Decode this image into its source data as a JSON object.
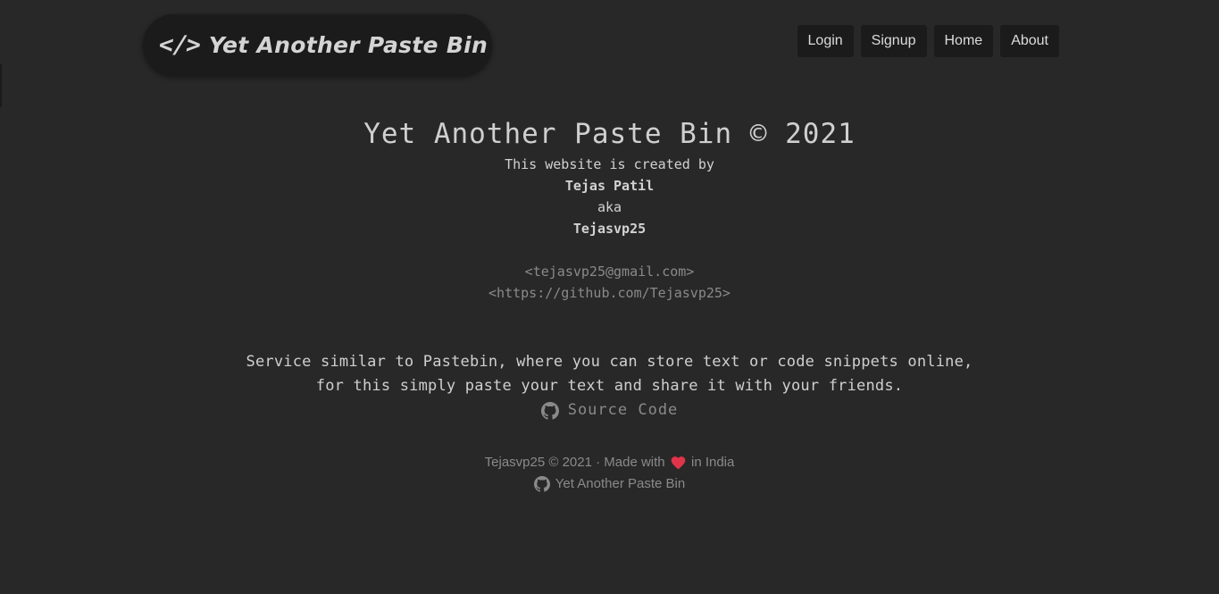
{
  "header": {
    "brand_code": "</>",
    "brand_text": "Yet Another Paste Bin",
    "nav": [
      "Login",
      "Signup",
      "Home",
      "About"
    ]
  },
  "about": {
    "title": "Yet Another Paste Bin © 2021",
    "created_by": "This website is created by",
    "author_name": "Tejas Patil",
    "aka": "aka",
    "author_handle": "Tejasvp25",
    "email": "<tejasvp25@gmail.com>",
    "github": "<https://github.com/Tejasvp25>",
    "description_1": "Service similar to Pastebin, where you can store text or code snippets online,",
    "description_2": "for this simply paste your text and share it with your friends.",
    "source_label": "Source Code"
  },
  "footer": {
    "copyright": "Tejasvp25 © 2021 · Made with",
    "location": "in India",
    "repo_label": "Yet Another Paste Bin"
  },
  "colors": {
    "background": "#282828",
    "heart": "#e0344a",
    "muted_text": "#8a8a8a"
  },
  "icons": [
    "github-icon",
    "heart-icon"
  ]
}
